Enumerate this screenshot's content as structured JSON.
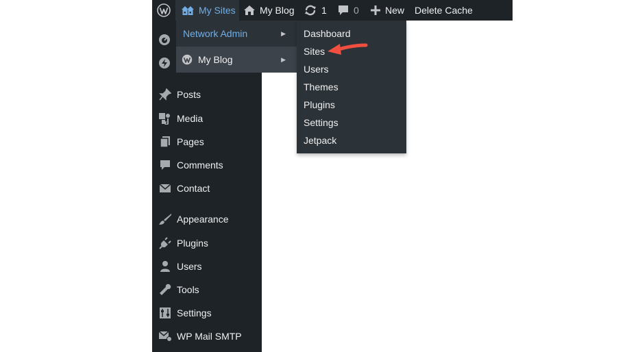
{
  "adminbar": {
    "my_sites": "My Sites",
    "my_blog": "My Blog",
    "updates_count": "1",
    "comments_count": "0",
    "new_label": "New",
    "delete_cache": "Delete Cache"
  },
  "flyout": {
    "network_admin": "Network Admin",
    "my_blog": "My Blog"
  },
  "network_submenu": [
    "Dashboard",
    "Sites",
    "Users",
    "Themes",
    "Plugins",
    "Settings",
    "Jetpack"
  ],
  "sidebar": {
    "items": [
      "Posts",
      "Media",
      "Pages",
      "Comments",
      "Contact",
      "Appearance",
      "Plugins",
      "Users",
      "Tools",
      "Settings",
      "WP Mail SMTP"
    ]
  },
  "colors": {
    "bar_bg": "#1d2327",
    "flyout_bg": "#2c3338",
    "highlight_bg": "#3c434a",
    "accent_blue": "#72aee6",
    "annotation_red": "#f04f3f"
  }
}
